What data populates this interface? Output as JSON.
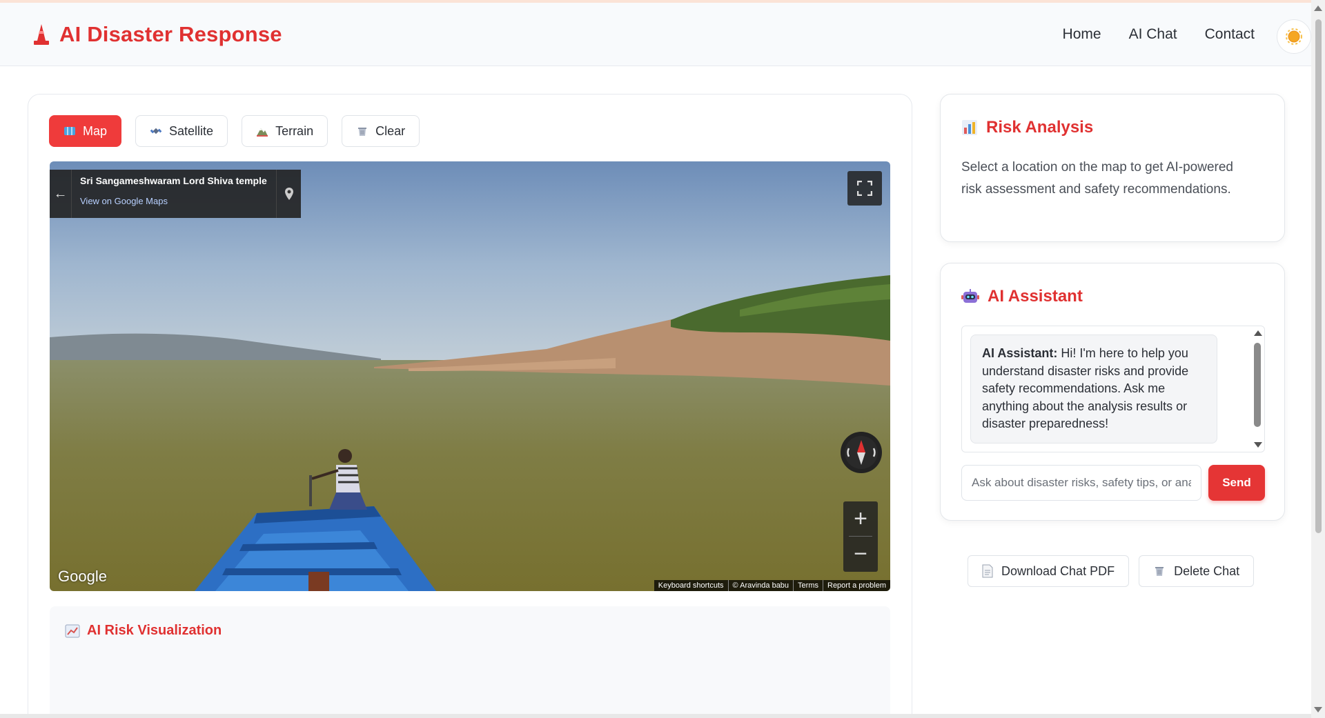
{
  "header": {
    "brand": "AI Disaster Response",
    "brand_icon": "cone-icon",
    "nav": [
      "Home",
      "AI Chat",
      "Contact"
    ],
    "theme_icon": "sun-icon"
  },
  "map_controls": {
    "map": "Map",
    "satellite": "Satellite",
    "terrain": "Terrain",
    "clear": "Clear"
  },
  "street_view": {
    "place_title": "Sri Sangameshwaram Lord Shiva temple",
    "view_link": "View on Google Maps",
    "google_logo": "Google",
    "attribution": [
      "Keyboard shortcuts",
      "© Aravinda babu",
      "Terms",
      "Report a problem"
    ],
    "zoom_in": "+",
    "zoom_out": "−"
  },
  "visualization": {
    "title": "AI Risk Visualization"
  },
  "risk_analysis": {
    "title": "Risk Analysis",
    "description": "Select a location on the map to get AI-powered risk assessment and safety recommendations."
  },
  "ai_assistant": {
    "title": "AI Assistant",
    "message_sender": "AI Assistant:",
    "message_text": " Hi! I'm here to help you understand disaster risks and provide safety recommendations. Ask me anything about the analysis results or disaster preparedness!",
    "input_placeholder": "Ask about disaster risks, safety tips, or analysis results...",
    "send_label": "Send"
  },
  "actions": {
    "download_pdf": "Download Chat PDF",
    "delete_chat": "Delete Chat"
  },
  "colors": {
    "accent": "#e03131",
    "button_active": "#ef3b3b"
  }
}
